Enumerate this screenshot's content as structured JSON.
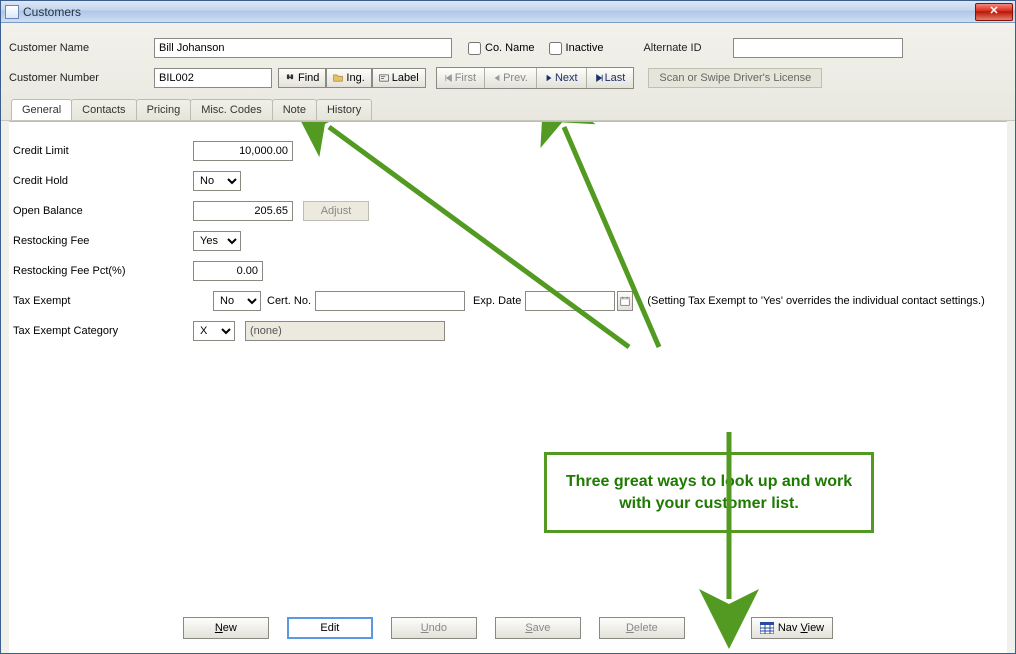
{
  "window": {
    "title": "Customers"
  },
  "header": {
    "customerNameLabel": "Customer Name",
    "customerName": "Bill Johanson",
    "coNameLabel": "Co. Name",
    "inactiveLabel": "Inactive",
    "alternateIdLabel": "Alternate ID",
    "alternateId": "",
    "customerNumberLabel": "Customer Number",
    "customerNumber": "BIL002",
    "findLabel": "Find",
    "ingLabel": "Ing.",
    "labelLabel": "Label",
    "nav": {
      "first": "First",
      "prev": "Prev.",
      "next": "Next",
      "last": "Last"
    },
    "scanLabel": "Scan or Swipe Driver's License"
  },
  "tabs": [
    "General",
    "Contacts",
    "Pricing",
    "Misc. Codes",
    "Note",
    "History"
  ],
  "general": {
    "creditLimitLabel": "Credit Limit",
    "creditLimit": "10,000.00",
    "creditHoldLabel": "Credit Hold",
    "creditHold": "No",
    "openBalanceLabel": "Open Balance",
    "openBalance": "205.65",
    "adjustLabel": "Adjust",
    "restockingFeeLabel": "Restocking Fee",
    "restockingFee": "Yes",
    "restockingPctLabel": "Restocking Fee Pct(%)",
    "restockingPct": "0.00",
    "taxExemptLabel": "Tax Exempt",
    "taxExempt": "No",
    "certNoLabel": "Cert. No.",
    "certNo": "",
    "expDateLabel": "Exp. Date",
    "expDate": "",
    "taxExemptHint": "(Setting Tax Exempt to 'Yes' overrides the individual contact settings.)",
    "taxExemptCatLabel": "Tax Exempt Category",
    "taxExemptCat": "X",
    "taxExemptCatDesc": "(none)"
  },
  "callout": "Three great ways to look up and work with your customer list.",
  "footer": {
    "new": "New",
    "edit": "Edit",
    "undo": "Undo",
    "save": "Save",
    "delete": "Delete",
    "navView": "Nav View"
  }
}
